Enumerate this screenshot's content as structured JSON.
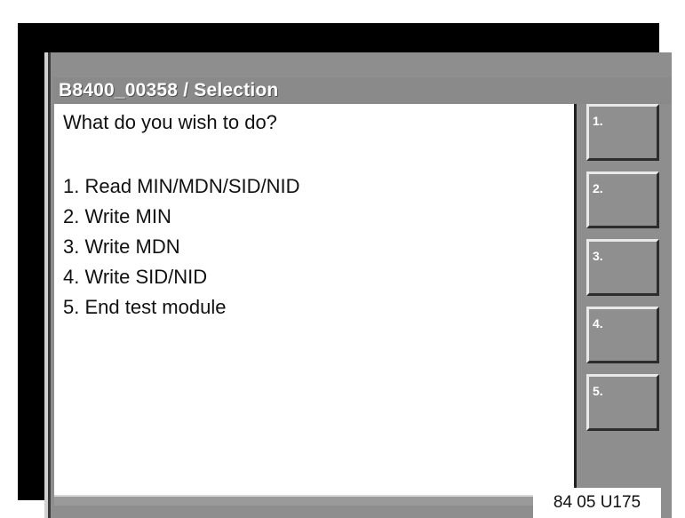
{
  "window": {
    "title": "B8400_00358 / Selection"
  },
  "content": {
    "prompt": "What do you wish to do?",
    "options": [
      "1. Read MIN/MDN/SID/NID",
      "2. Write MIN",
      "3. Write MDN",
      "4. Write SID/NID",
      "5. End test module"
    ]
  },
  "softkeys": [
    {
      "label": "1."
    },
    {
      "label": "2."
    },
    {
      "label": "3."
    },
    {
      "label": "4."
    },
    {
      "label": "5."
    }
  ],
  "figure_code": "84 05 U175",
  "colors": {
    "frame": "#000000",
    "panel": "#8e8e8e",
    "content_bg": "#ffffff",
    "title_text": "#ffffff"
  }
}
